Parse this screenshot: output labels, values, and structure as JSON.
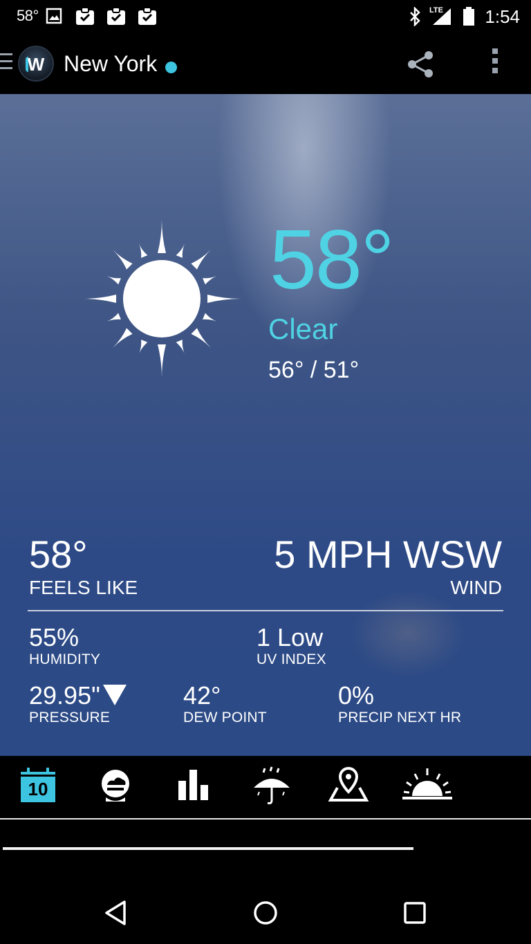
{
  "status_bar": {
    "temp": "58°",
    "time": "1:54",
    "network_label": "LTE",
    "icons": [
      "image-icon",
      "clipboard-check-icon",
      "clipboard-check-icon",
      "clipboard-check-icon",
      "bluetooth-icon",
      "signal-icon",
      "battery-icon"
    ]
  },
  "app_bar": {
    "logo": "W",
    "city": "New York",
    "status_dot_color": "#3dc4e0",
    "actions": [
      "share-icon",
      "overflow-menu-icon"
    ]
  },
  "current": {
    "temperature": "58°",
    "condition": "Clear",
    "hi_lo": "56° / 51°",
    "condition_icon": "sun-icon",
    "accent_color": "#4fd3e4"
  },
  "details": {
    "feels_like": {
      "value": "58°",
      "label": "FEELS LIKE"
    },
    "wind": {
      "value": "5 MPH WSW",
      "label": "WIND"
    },
    "humidity": {
      "value": "55%",
      "label": "HUMIDITY"
    },
    "uv_index": {
      "value": "1 Low",
      "label": "UV INDEX"
    },
    "pressure": {
      "value": "29.95\"",
      "label": "PRESSURE",
      "trend": "falling"
    },
    "dew_point": {
      "value": "42°",
      "label": "DEW POINT"
    },
    "precip": {
      "value": "0%",
      "label": "PRECIP NEXT HR"
    }
  },
  "bottom_nav": {
    "items": [
      {
        "icon": "calendar-10-day-icon",
        "badge": "10",
        "active": true
      },
      {
        "icon": "current-conditions-icon"
      },
      {
        "icon": "bar-chart-icon"
      },
      {
        "icon": "umbrella-rain-icon"
      },
      {
        "icon": "map-pin-icon"
      },
      {
        "icon": "sunrise-icon"
      }
    ],
    "active_color": "#3dc4e0"
  },
  "system_nav": [
    "back-icon",
    "home-icon",
    "recents-icon"
  ]
}
